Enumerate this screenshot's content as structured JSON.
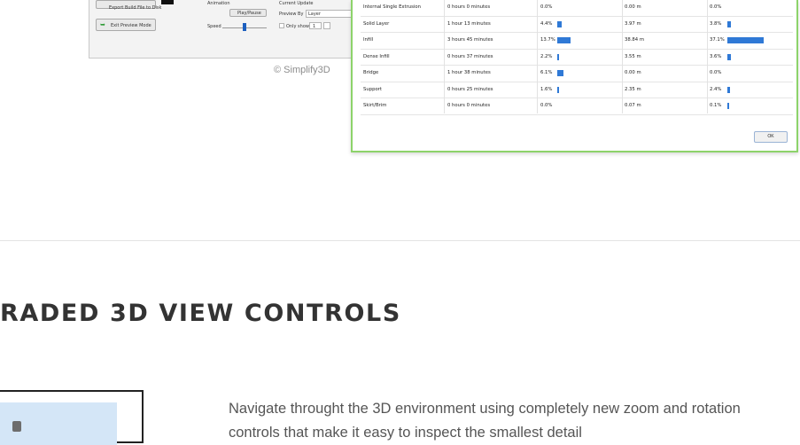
{
  "app": {
    "export_label": "Export Build File to Disk",
    "exit_label": "Exit Preview Mode",
    "animation_label": "Animation",
    "play_pause_label": "Play/Pause",
    "speed_label": "Speed",
    "current_update_label": "Current Update",
    "preview_by_label": "Preview By",
    "preview_by_value": "Layer",
    "only_show_label": "Only show",
    "only_show_value": "1",
    "watermark": "© Simplify3D"
  },
  "stats": {
    "rows": [
      {
        "feature": "Internal Single Extrusion",
        "time": "0 hours 0 minutes",
        "pct": "0.0%",
        "pct_bar": 0,
        "len": "0.00 m",
        "len_pct": "0.0%",
        "len_bar": 0
      },
      {
        "feature": "Solid Layer",
        "time": "1 hour 13 minutes",
        "pct": "4.4%",
        "pct_bar": 0.044,
        "len": "3.97 m",
        "len_pct": "3.8%",
        "len_bar": 0.038
      },
      {
        "feature": "Infill",
        "time": "3 hours 45 minutes",
        "pct": "13.7%",
        "pct_bar": 0.137,
        "len": "38.84 m",
        "len_pct": "37.1%",
        "len_bar": 0.371
      },
      {
        "feature": "Dense Infill",
        "time": "0 hours 37 minutes",
        "pct": "2.2%",
        "pct_bar": 0.022,
        "len": "3.55 m",
        "len_pct": "3.6%",
        "len_bar": 0.036
      },
      {
        "feature": "Bridge",
        "time": "1 hour 38 minutes",
        "pct": "6.1%",
        "pct_bar": 0.061,
        "len": "0.00 m",
        "len_pct": "0.0%",
        "len_bar": 0
      },
      {
        "feature": "Support",
        "time": "0 hours 25 minutes",
        "pct": "1.6%",
        "pct_bar": 0.016,
        "len": "2.35 m",
        "len_pct": "2.4%",
        "len_bar": 0.024
      },
      {
        "feature": "Skirt/Brim",
        "time": "0 hours 0 minutes",
        "pct": "0.0%",
        "pct_bar": 0,
        "len": "0.07 m",
        "len_pct": "0.1%",
        "len_bar": 0.001
      }
    ],
    "ok_label": "OK",
    "bar_color": "#2f79d6"
  },
  "section": {
    "heading": "RADED 3D VIEW CONTROLS",
    "description": "Navigate throught the 3D environment using completely new zoom and rotation controls that make it easy to inspect the smallest detail"
  }
}
